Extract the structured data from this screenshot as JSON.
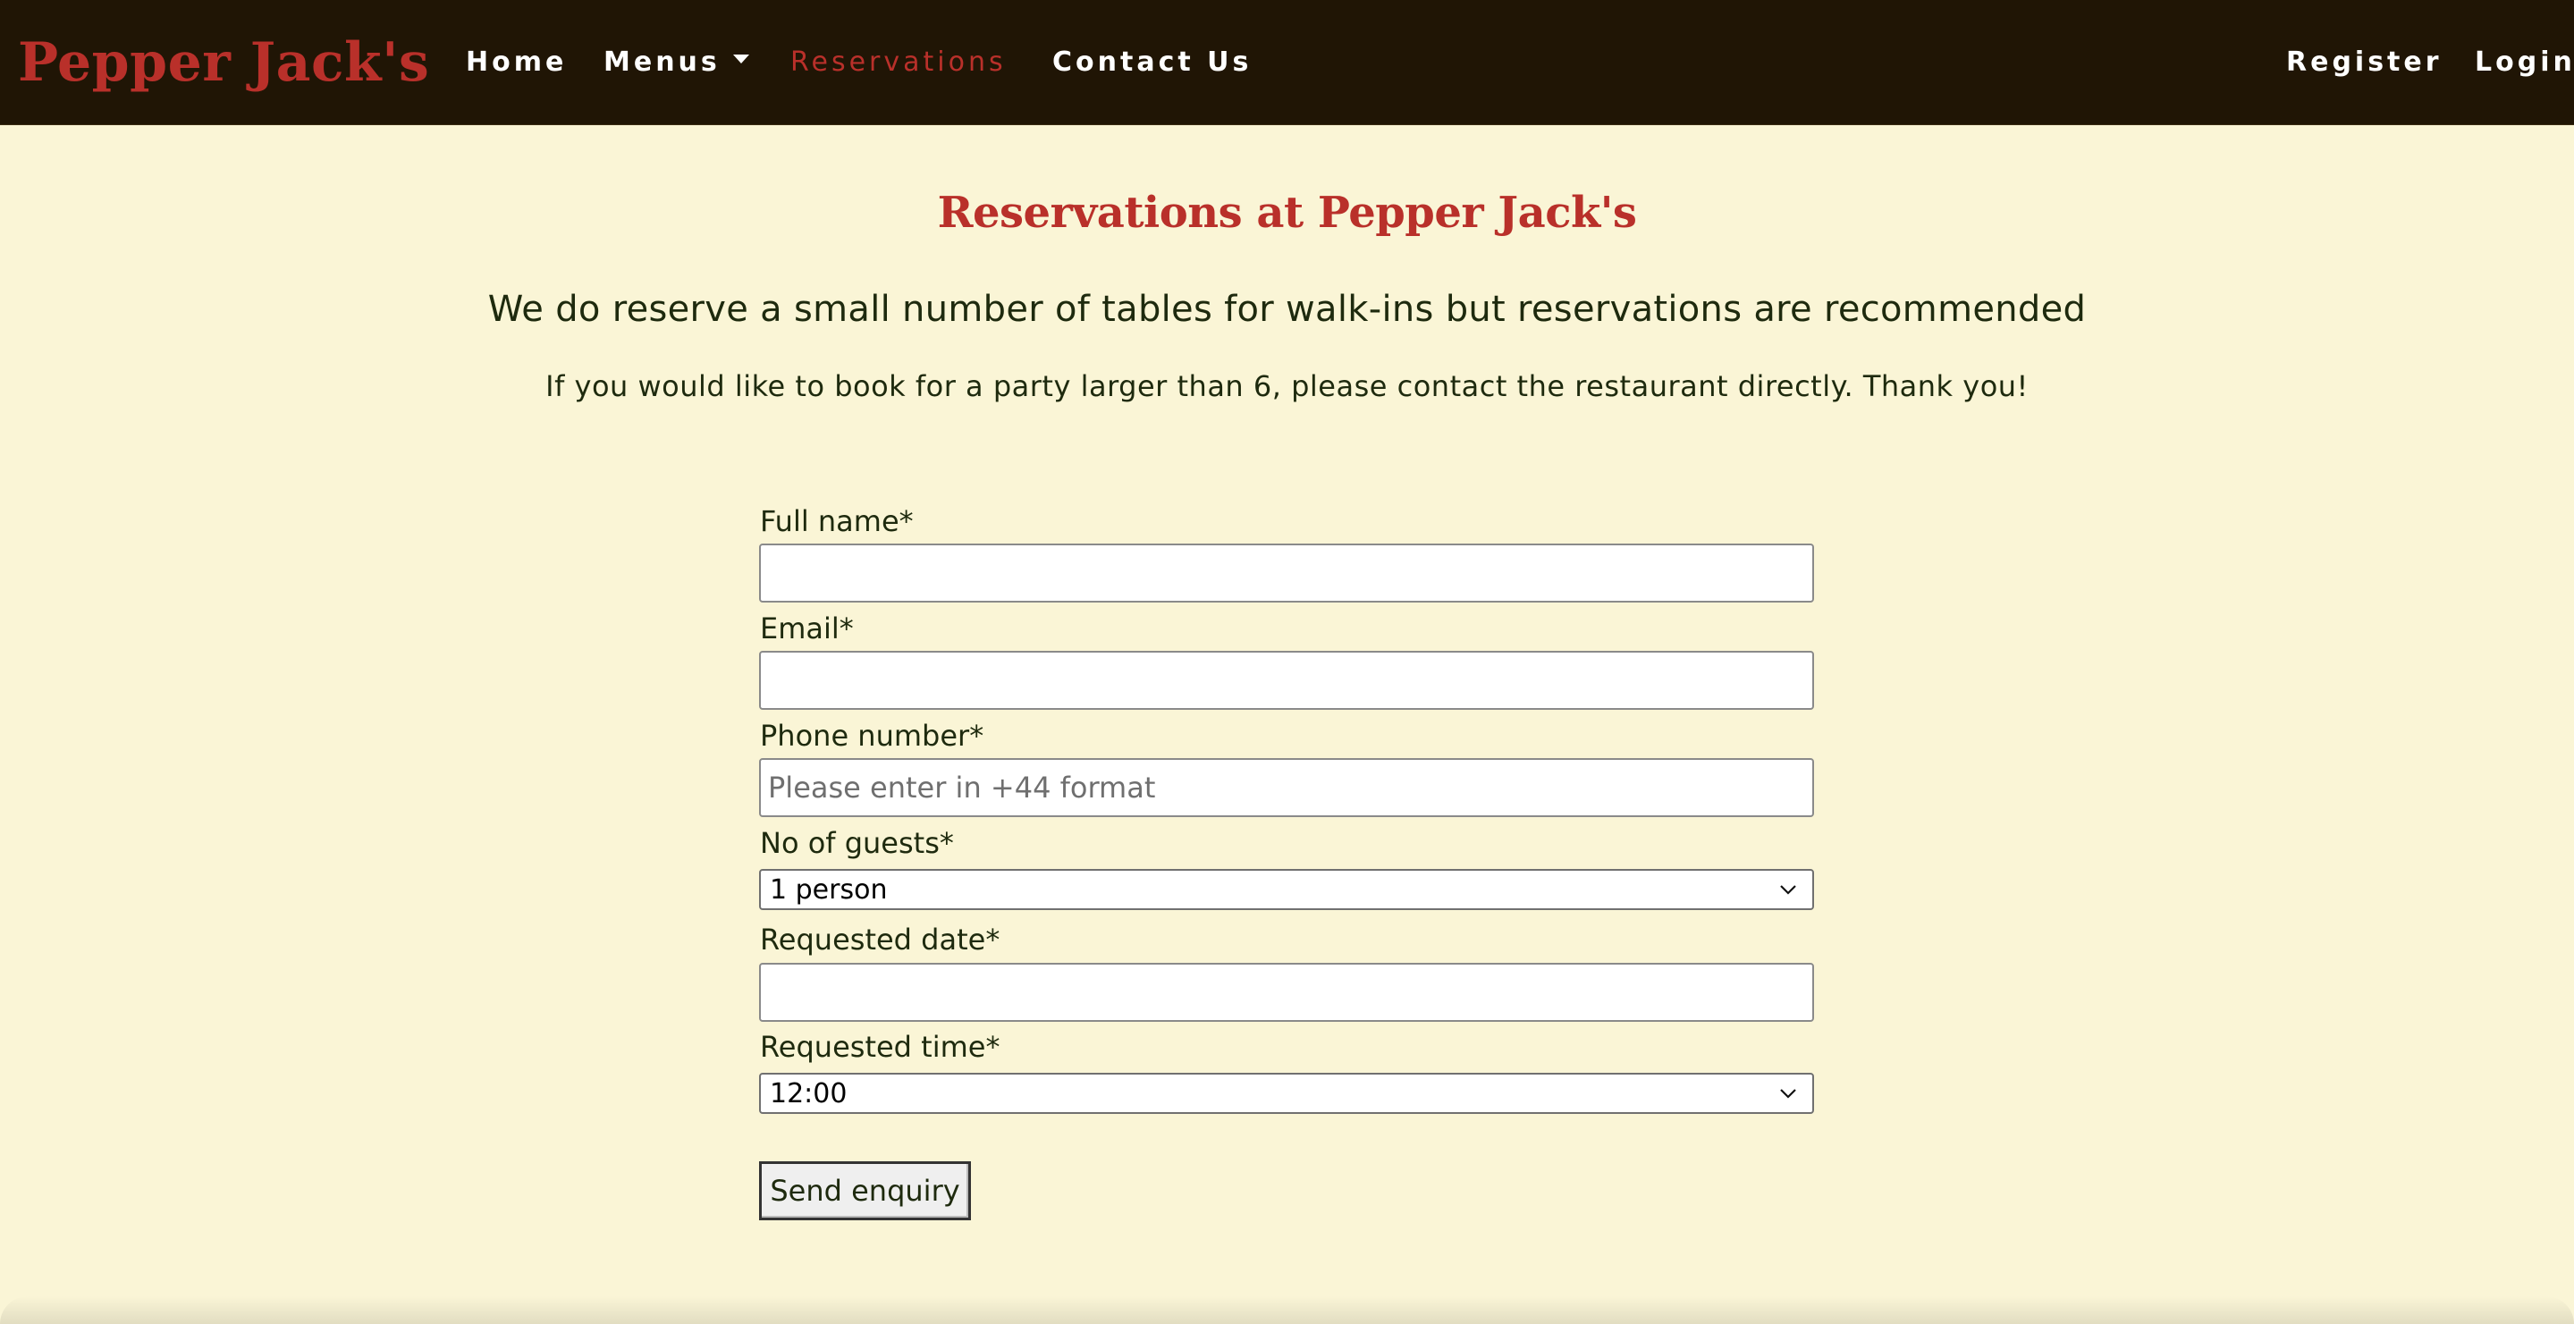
{
  "navbar": {
    "brand": "Pepper Jack's",
    "links": {
      "home": "Home",
      "menus": "Menus",
      "reservations": "Reservations",
      "contact": "Contact Us",
      "register": "Register",
      "login": "Login"
    },
    "active": "reservations"
  },
  "content": {
    "title": "Reservations at Pepper Jack's",
    "lead": "We do reserve a small number of tables for walk-ins but reservations are recommended",
    "note": "If you would like to book for a party larger than 6, please contact the restaurant directly. Thank you!"
  },
  "form": {
    "full_name": {
      "label": "Full name*",
      "value": ""
    },
    "email": {
      "label": "Email*",
      "value": ""
    },
    "phone": {
      "label": "Phone number*",
      "value": "",
      "placeholder": "Please enter in +44 format"
    },
    "guests": {
      "label": "No of guests*",
      "selected": "1 person"
    },
    "date": {
      "label": "Requested date*",
      "value": ""
    },
    "time": {
      "label": "Requested time*",
      "selected": "12:00"
    },
    "submit_label": "Send enquiry"
  },
  "colors": {
    "navbar_bg": "#201505",
    "page_bg": "#FAF5D6",
    "accent_red": "#B9302A",
    "text_dark": "#1E2A0E"
  },
  "icons": {
    "dropdown_caret": "caret-down-icon",
    "select_chevron": "chevron-down-icon"
  }
}
